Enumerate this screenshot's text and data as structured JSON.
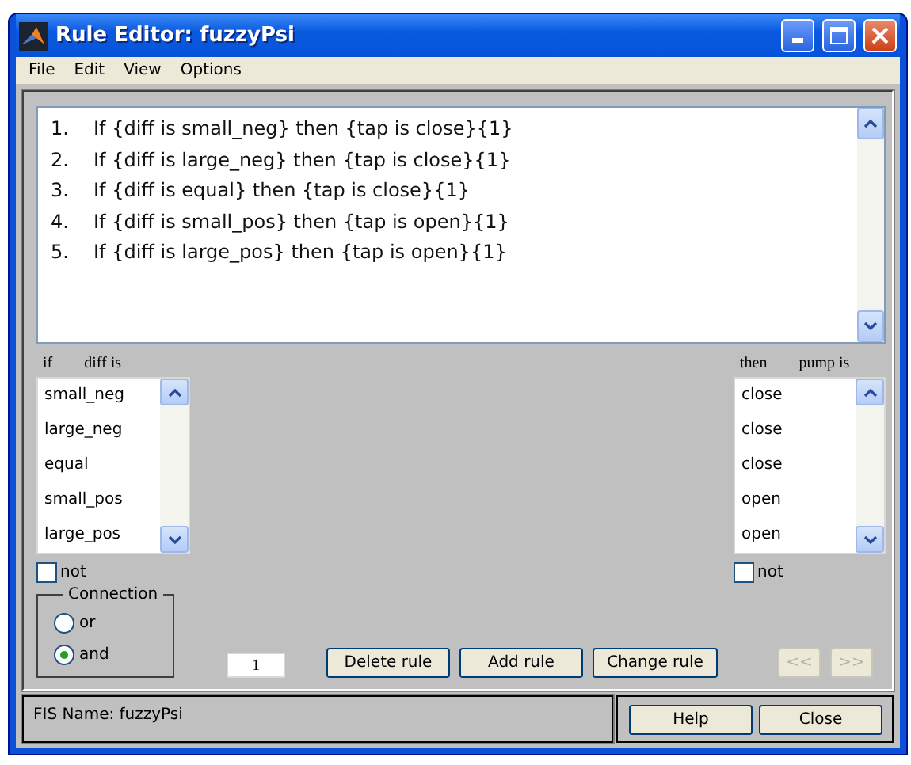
{
  "window": {
    "title": "Rule Editor: fuzzyPsi"
  },
  "menu": [
    "File",
    "Edit",
    "View",
    "Options"
  ],
  "rules": [
    {
      "number": "1.",
      "text": "If {diff is small_neg} then {tap is close}{1}"
    },
    {
      "number": "2.",
      "text": "If {diff is large_neg} then {tap is close}{1}"
    },
    {
      "number": "3.",
      "text": "If {diff is equal} then {tap is close}{1}"
    },
    {
      "number": "4.",
      "text": "If {diff is small_pos} then {tap is open}{1}"
    },
    {
      "number": "5.",
      "text": "If {diff is large_pos} then {tap is open}{1}"
    }
  ],
  "input": {
    "if_label": "if",
    "variable_label": "diff is",
    "items": [
      "small_neg",
      "large_neg",
      "equal",
      "small_pos",
      "large_pos"
    ],
    "not": {
      "label": "not",
      "checked": false
    }
  },
  "output": {
    "then_label": "then",
    "variable_label": "pump is",
    "items": [
      "close",
      "close",
      "close",
      "open",
      "open"
    ],
    "not": {
      "label": "not",
      "checked": false
    }
  },
  "connection": {
    "title": "Connection",
    "options": [
      {
        "label": "or",
        "selected": false
      },
      {
        "label": "and",
        "selected": true
      }
    ]
  },
  "weight": "1",
  "buttons": [
    "Delete rule",
    "Add rule",
    "Change rule"
  ],
  "nav_buttons": [
    {
      "label": "<<",
      "disabled": true
    },
    {
      "label": ">>",
      "disabled": true
    }
  ],
  "status": "FIS Name: fuzzyPsi",
  "footer_buttons": [
    "Help",
    "Close"
  ]
}
